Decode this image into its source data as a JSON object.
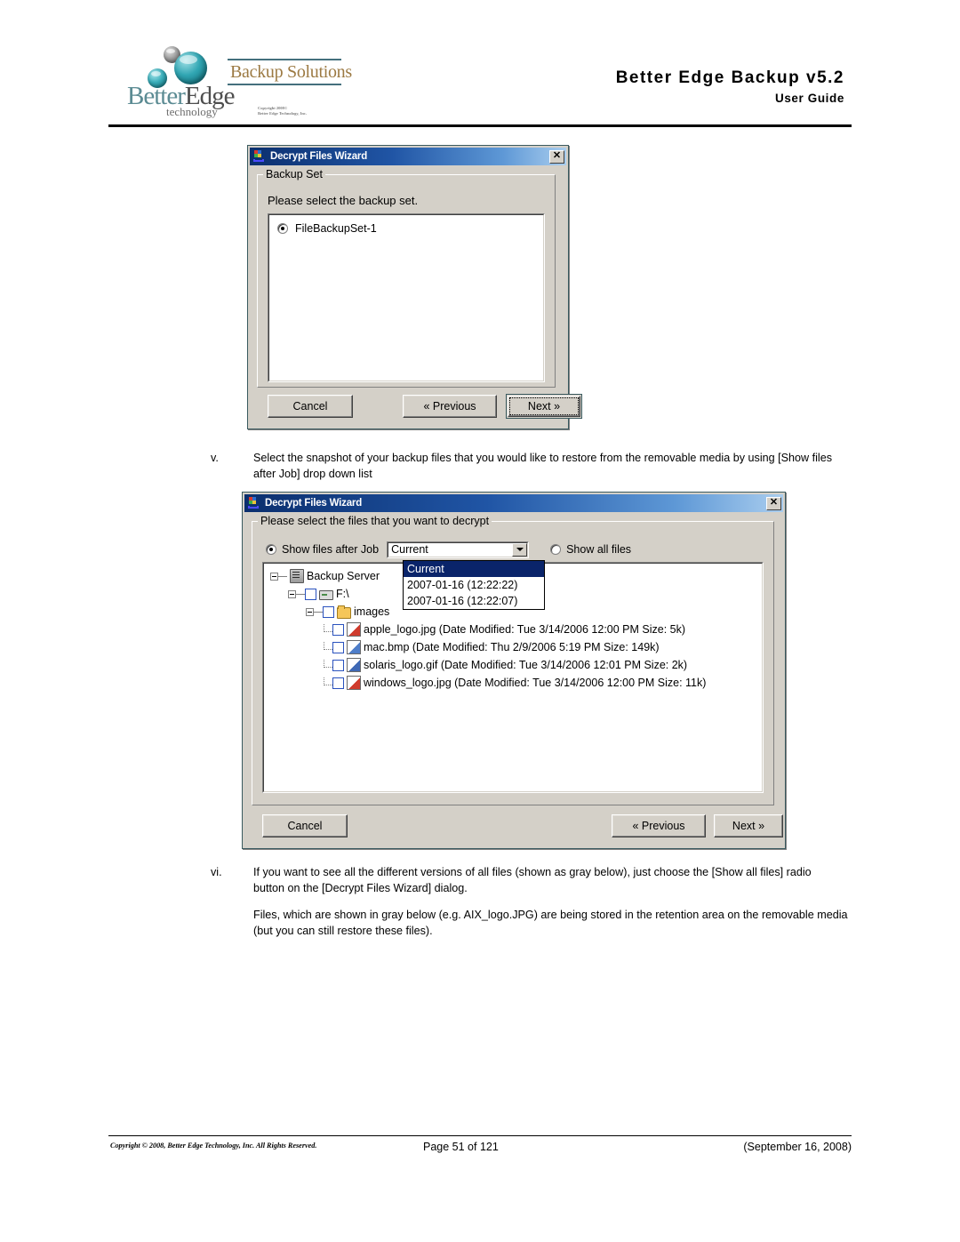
{
  "header": {
    "logo": {
      "brand_part1": "Better",
      "brand_part2": "Edge",
      "tagline": "technology",
      "product_line": "Backup Solutions",
      "copyright_line1": "Copyright 2008©",
      "copyright_line2": "Better Edge Technology, Inc."
    },
    "title": "Better Edge Backup  v5.2",
    "subtitle": "User Guide"
  },
  "dialog1": {
    "title": "Decrypt Files Wizard",
    "close_label": "✕",
    "group_legend": "Backup Set",
    "prompt": "Please select the backup set.",
    "backup_sets": [
      {
        "label": "FileBackupSet-1",
        "selected": true
      }
    ],
    "buttons": {
      "cancel": "Cancel",
      "previous": "« Previous",
      "next": "Next »"
    }
  },
  "step_v": {
    "marker": "v.",
    "text": "Select the snapshot of your backup files that you would like to restore from the removable media by using [Show files after Job] drop down list"
  },
  "dialog2": {
    "title": "Decrypt Files Wizard",
    "close_label": "✕",
    "group_legend": "Please select the files that you want to decrypt",
    "radio_show_after_job": "Show files after Job",
    "radio_show_all_files": "Show all files",
    "combo_value": "Current",
    "combo_options": [
      {
        "label": "Current",
        "selected": true
      },
      {
        "label": "2007-01-16 (12:22:22)",
        "selected": false
      },
      {
        "label": "2007-01-16 (12:22:07)",
        "selected": false
      }
    ],
    "tree": [
      {
        "label": "Backup Server",
        "icon": "server-icon",
        "depth": 0,
        "checkbox": false
      },
      {
        "label": "F:\\",
        "icon": "drive-icon",
        "depth": 1,
        "checkbox": true
      },
      {
        "label": "images",
        "icon": "folder-icon",
        "depth": 2,
        "checkbox": true
      },
      {
        "label": "apple_logo.jpg (Date Modified: Tue 3/14/2006 12:00 PM Size: 5k)",
        "icon": "jpg-file-icon",
        "depth": 3,
        "checkbox": true
      },
      {
        "label": "mac.bmp (Date Modified: Thu 2/9/2006 5:19 PM Size: 149k)",
        "icon": "bmp-file-icon",
        "depth": 3,
        "checkbox": true
      },
      {
        "label": "solaris_logo.gif (Date Modified: Tue 3/14/2006 12:01 PM Size: 2k)",
        "icon": "gif-file-icon",
        "depth": 3,
        "checkbox": true
      },
      {
        "label": "windows_logo.jpg (Date Modified: Tue 3/14/2006 12:00 PM Size: 11k)",
        "icon": "jpg-file-icon",
        "depth": 3,
        "checkbox": true
      }
    ],
    "buttons": {
      "cancel": "Cancel",
      "previous": "« Previous",
      "next": "Next »"
    }
  },
  "step_vi": {
    "marker": "vi.",
    "text": "If you want to see all the different versions of all files (shown as gray below), just choose the [Show all files] radio button on the [Decrypt Files Wizard] dialog."
  },
  "note": {
    "text": "Files, which are shown in gray below (e.g. AIX_logo.JPG) are being stored in the retention area on the removable media (but you can still restore these files)."
  },
  "footer": {
    "copyright": "Copyright © 2008, Better Edge Technology, Inc.   All Rights Reserved.",
    "page": "Page 51 of  121",
    "date": "(September 16, 2008)"
  }
}
